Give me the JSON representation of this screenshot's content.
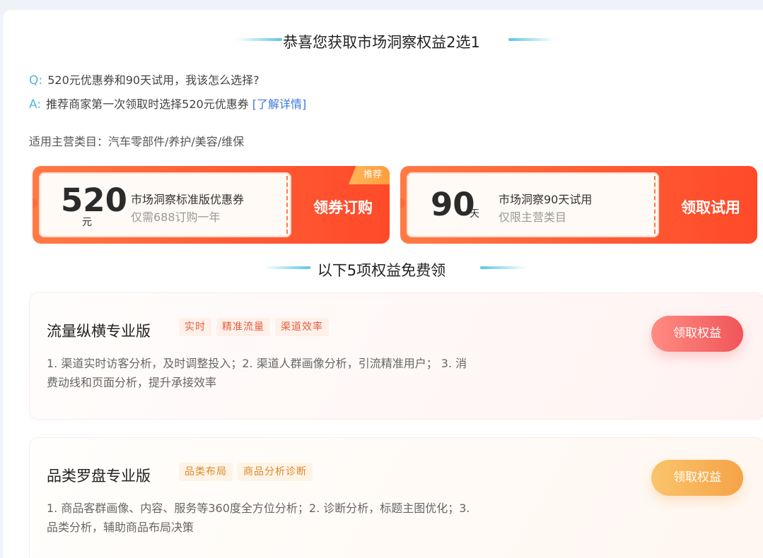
{
  "header": {
    "title": "恭喜您获取市场洞察权益2选1"
  },
  "qa": {
    "q_tag": "Q:",
    "question": "520元优惠券和90天试用，我该怎么选择?",
    "a_tag": "A:",
    "answer": "推荐商家第一次领取时选择520元优惠券",
    "link": "[了解详情]"
  },
  "category": "适用主营类目：汽车零部件/养护/美容/维保",
  "coupons": [
    {
      "amount": "520",
      "unit": "元",
      "title": "市场洞察标准版优惠券",
      "subtitle": "仅需688订购一年",
      "action": "领券订购",
      "badge": "推荐"
    },
    {
      "amount": "90",
      "unit": "天",
      "title": "市场洞察90天试用",
      "subtitle": "仅限主营类目",
      "action": "领取试用"
    }
  ],
  "free_section": {
    "title": "以下5项权益免费领"
  },
  "benefits": [
    {
      "title": "流量纵横专业版",
      "tags": [
        "实时",
        "精准流量",
        "渠道效率"
      ],
      "description": "1. 渠道实时访客分析，及时调整投入；2. 渠道人群画像分析，引流精准用户；  3. 消费动线和页面分析，提升承接效率",
      "button": "领取权益"
    },
    {
      "title": "品类罗盘专业版",
      "tags": [
        "品类布局",
        "商品分析诊断"
      ],
      "description": "1. 商品客群画像、内容、服务等360度全方位分析；2. 诊断分析，标题主图优化；3. 品类分析，辅助商品布局决策",
      "button": "领取权益"
    }
  ],
  "colors": {
    "accent_blue": "#4fb8e0",
    "link_blue": "#3c78d8",
    "coupon_red": "#ff5a33",
    "button_red": "#f0555a",
    "button_orange": "#f5a347"
  }
}
